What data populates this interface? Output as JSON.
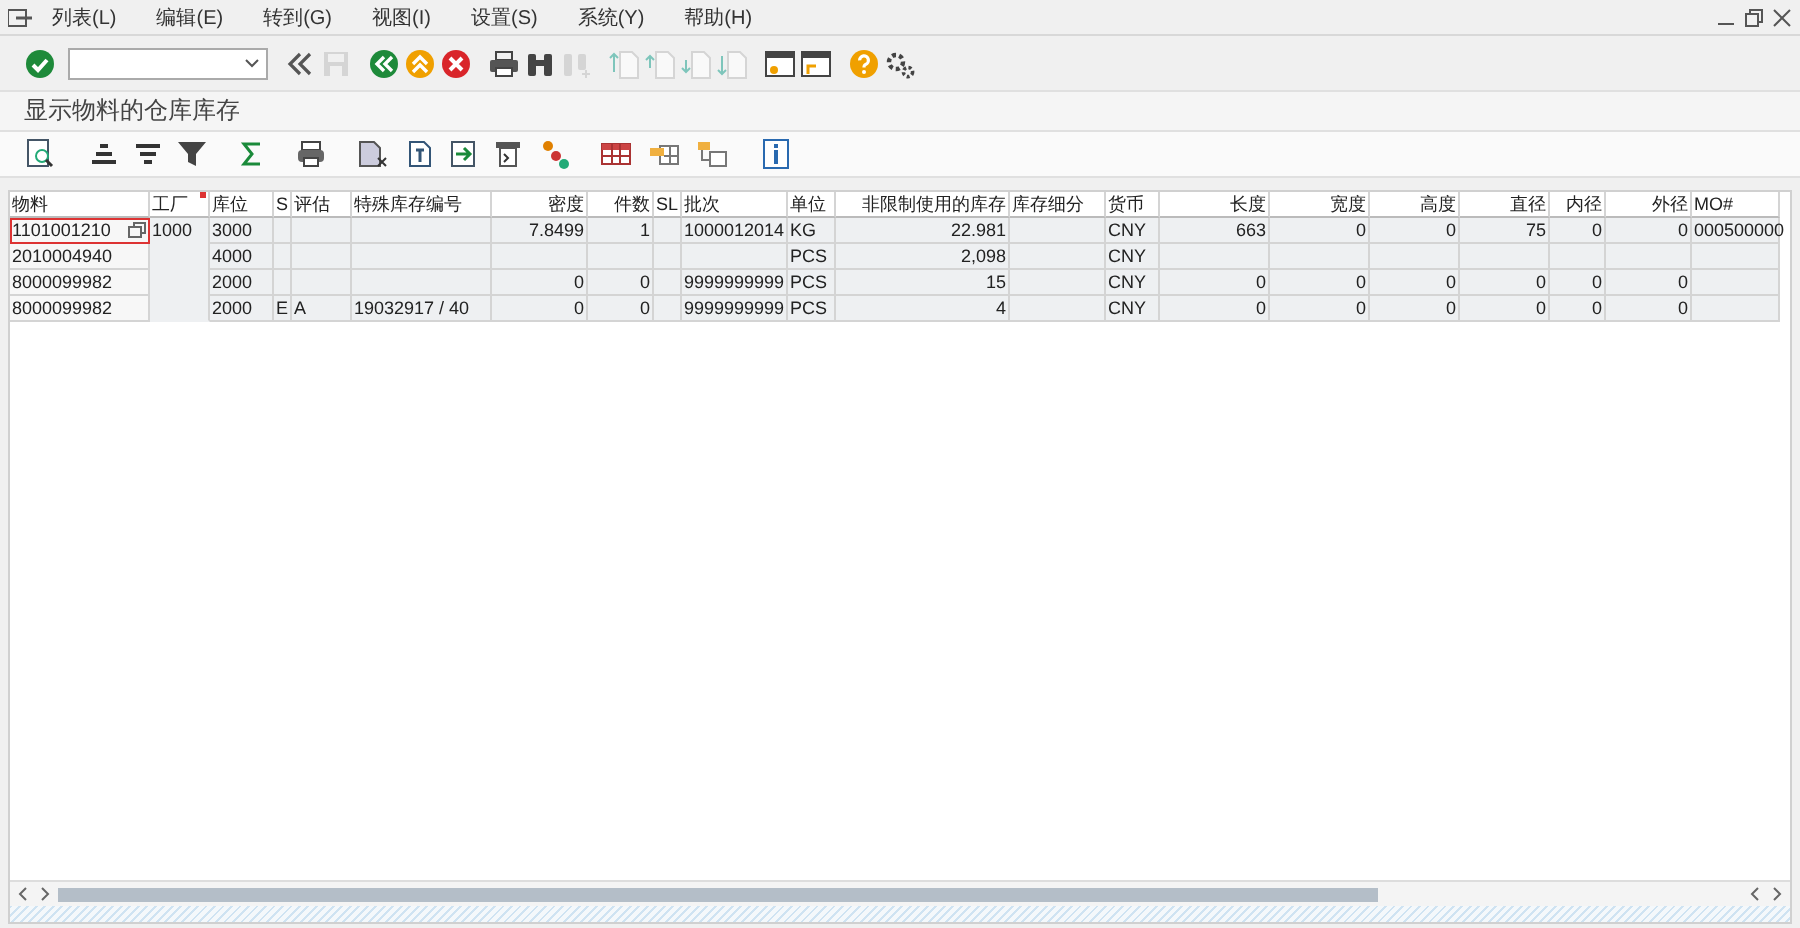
{
  "menu": [
    "列表(L)",
    "编辑(E)",
    "转到(G)",
    "视图(I)",
    "设置(S)",
    "系统(Y)",
    "帮助(H)"
  ],
  "toolbar": [
    {
      "kind": "enter",
      "disabled": false
    },
    {
      "kind": "command-field",
      "disabled": false
    },
    {
      "kind": "collapse",
      "disabled": false
    },
    {
      "kind": "save",
      "disabled": true
    },
    {
      "kind": "back",
      "disabled": false
    },
    {
      "kind": "exit",
      "disabled": false
    },
    {
      "kind": "cancel",
      "disabled": false
    },
    {
      "kind": "print",
      "disabled": false
    },
    {
      "kind": "find",
      "disabled": false
    },
    {
      "kind": "find-next",
      "disabled": true
    },
    {
      "kind": "first-page",
      "disabled": true
    },
    {
      "kind": "prev-page",
      "disabled": true
    },
    {
      "kind": "next-page",
      "disabled": true
    },
    {
      "kind": "last-page",
      "disabled": true
    },
    {
      "kind": "new-session",
      "disabled": false
    },
    {
      "kind": "shortcut",
      "disabled": false
    },
    {
      "kind": "help",
      "disabled": false
    },
    {
      "kind": "settings",
      "disabled": false
    }
  ],
  "title": "显示物料的仓库库存",
  "alv_toolbar": [
    {
      "kind": "details"
    },
    {
      "kind": "sort-up"
    },
    {
      "kind": "sort-down"
    },
    {
      "kind": "filter"
    },
    {
      "kind": "sum"
    },
    {
      "kind": "print"
    },
    {
      "kind": "export"
    },
    {
      "kind": "document"
    },
    {
      "kind": "file"
    },
    {
      "kind": "form"
    },
    {
      "kind": "abc"
    },
    {
      "kind": "grid"
    },
    {
      "kind": "layout"
    },
    {
      "kind": "layout-select"
    },
    {
      "kind": "info"
    }
  ],
  "table": {
    "columns": [
      {
        "label": "物料",
        "sorted": false
      },
      {
        "label": "工厂",
        "sorted": true
      },
      {
        "label": "库位",
        "sorted": false
      },
      {
        "label": "S",
        "sorted": false
      },
      {
        "label": "评估",
        "sorted": false
      },
      {
        "label": "特殊库存编号",
        "sorted": false
      },
      {
        "label": "密度",
        "sorted": false
      },
      {
        "label": "件数",
        "sorted": false
      },
      {
        "label": "SL",
        "sorted": false
      },
      {
        "label": "批次",
        "sorted": false
      },
      {
        "label": "单位",
        "sorted": false
      },
      {
        "label": "非限制使用的库存",
        "sorted": false
      },
      {
        "label": "库存细分",
        "sorted": false
      },
      {
        "label": "货币",
        "sorted": false
      },
      {
        "label": "长度",
        "sorted": false
      },
      {
        "label": "宽度",
        "sorted": false
      },
      {
        "label": "高度",
        "sorted": false
      },
      {
        "label": "直径",
        "sorted": false
      },
      {
        "label": "内径",
        "sorted": false
      },
      {
        "label": "外径",
        "sorted": false
      },
      {
        "label": "MO#",
        "sorted": false
      }
    ],
    "rows": [
      {
        "current": true,
        "cells": [
          "1101001210",
          "1000",
          "3000",
          null,
          null,
          null,
          "7.8499",
          "1",
          null,
          "1000012014",
          "KG",
          "22.981",
          null,
          "CNY",
          "663",
          "0",
          "0",
          "75",
          "0",
          "0",
          "000500000"
        ]
      },
      {
        "current": false,
        "cells": [
          "2010004940",
          null,
          "4000",
          null,
          null,
          null,
          null,
          null,
          null,
          null,
          "PCS",
          "2,098",
          null,
          "CNY",
          null,
          null,
          null,
          null,
          null,
          null,
          null
        ]
      },
      {
        "current": false,
        "cells": [
          "8000099982",
          null,
          "2000",
          null,
          null,
          null,
          "0",
          "0",
          null,
          "9999999999",
          "PCS",
          "15",
          null,
          "CNY",
          "0",
          "0",
          "0",
          "0",
          "0",
          "0",
          null
        ]
      },
      {
        "current": false,
        "cells": [
          "8000099982",
          null,
          "2000",
          "E",
          "A",
          "19032917 / 40",
          "0",
          "0",
          null,
          "9999999999",
          "PCS",
          "4",
          null,
          "CNY",
          "0",
          "0",
          "0",
          "0",
          "0",
          "0",
          null
        ]
      }
    ]
  }
}
